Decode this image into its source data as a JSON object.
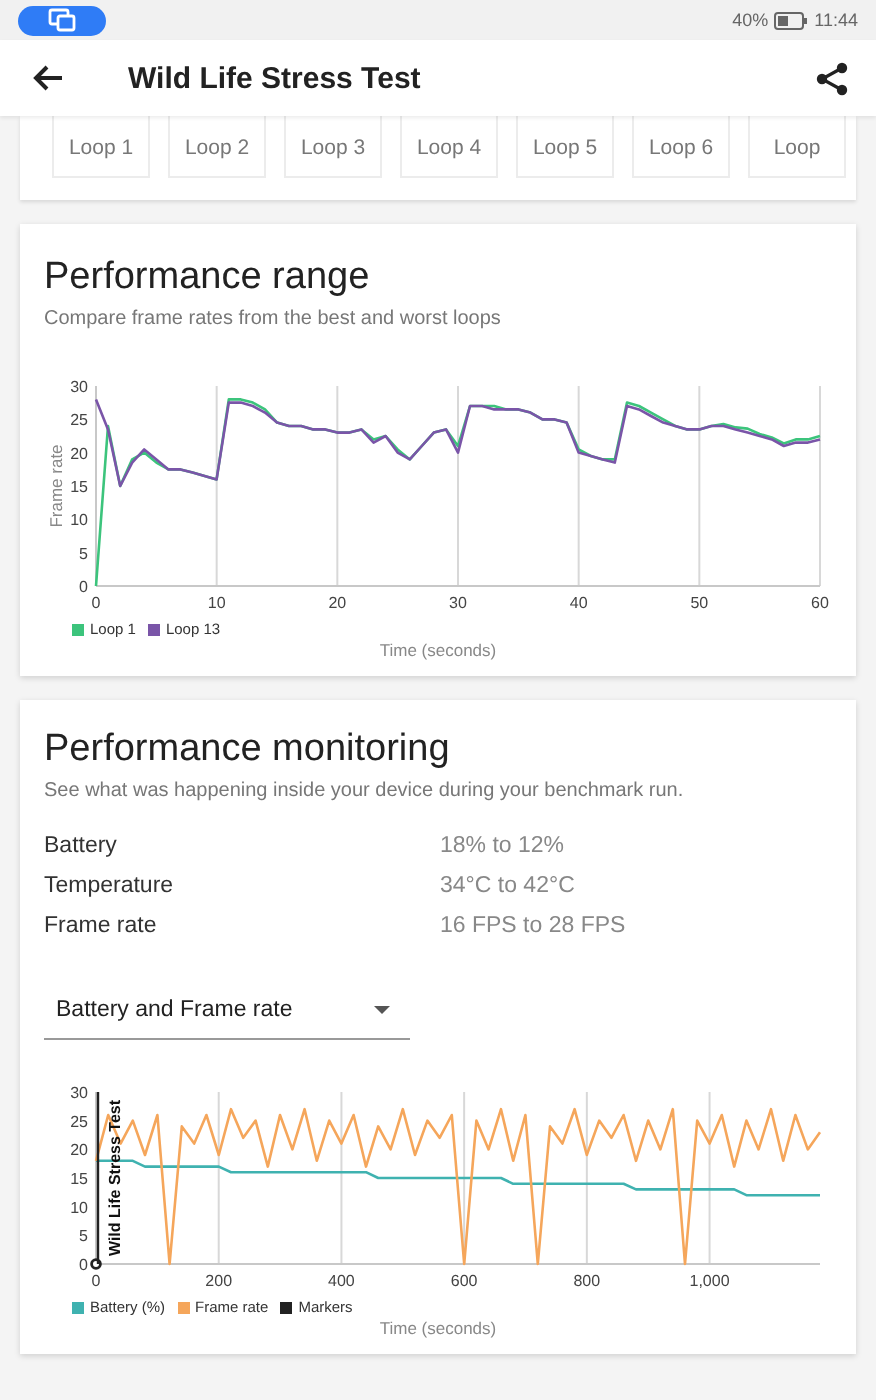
{
  "status_bar": {
    "battery_text": "40%",
    "time": "11:44"
  },
  "app_bar": {
    "title": "Wild Life Stress Test"
  },
  "loops": [
    "Loop 1",
    "Loop 2",
    "Loop 3",
    "Loop 4",
    "Loop 5",
    "Loop 6",
    "Loop"
  ],
  "performance_range": {
    "title": "Performance range",
    "subtitle": "Compare frame rates from the best and worst loops",
    "chart_data": {
      "type": "line",
      "grid": true,
      "legend": "bottom-left",
      "xlabel": "Time (seconds)",
      "ylabel": "Frame rate",
      "xlim": [
        0,
        60
      ],
      "ylim": [
        0,
        30
      ],
      "xticks": [
        0,
        10,
        20,
        30,
        40,
        50,
        60
      ],
      "yticks": [
        0,
        5,
        10,
        15,
        20,
        25,
        30
      ],
      "x": [
        0,
        1,
        2,
        3,
        4,
        5,
        6,
        7,
        8,
        9,
        10,
        11,
        12,
        13,
        14,
        15,
        16,
        17,
        18,
        19,
        20,
        21,
        22,
        23,
        24,
        25,
        26,
        27,
        28,
        29,
        30,
        31,
        32,
        33,
        34,
        35,
        36,
        37,
        38,
        39,
        40,
        41,
        42,
        43,
        44,
        45,
        46,
        47,
        48,
        49,
        50,
        51,
        52,
        53,
        54,
        55,
        56,
        57,
        58,
        59,
        60
      ],
      "series": [
        {
          "name": "Loop 1",
          "color": "#3cc47c",
          "values": [
            0,
            24,
            15,
            19,
            20,
            18.5,
            17.5,
            17.5,
            17,
            16.5,
            16,
            28,
            28,
            27.5,
            26.5,
            24.5,
            24,
            24,
            23.5,
            23.5,
            23,
            23,
            23.5,
            22,
            22.5,
            20.5,
            19,
            21,
            23,
            23.5,
            21,
            27,
            27,
            27,
            26.5,
            26.5,
            26,
            25,
            25,
            24.5,
            20.5,
            19.5,
            19,
            19,
            27.5,
            27,
            26,
            25,
            24,
            23.5,
            23.5,
            24,
            24.3,
            23.8,
            23.6,
            22.8,
            22.3,
            21.4,
            22,
            22,
            22.5
          ]
        },
        {
          "name": "Loop 13",
          "color": "#7a55a8",
          "values": [
            28,
            23.5,
            15,
            18.5,
            20.5,
            19,
            17.5,
            17.5,
            17,
            16.5,
            16,
            27.5,
            27.5,
            27,
            26,
            24.5,
            24,
            24,
            23.5,
            23.5,
            23,
            23,
            23.5,
            21.5,
            22.5,
            20,
            19,
            21,
            23,
            23.5,
            20,
            27,
            27,
            26.5,
            26.5,
            26.5,
            26,
            25,
            25,
            24.5,
            20,
            19.5,
            19,
            18.5,
            27,
            26.5,
            25.5,
            24.5,
            24,
            23.5,
            23.5,
            24,
            24,
            23.5,
            23,
            22.5,
            22,
            21,
            21.5,
            21.5,
            22
          ]
        }
      ]
    }
  },
  "performance_monitoring": {
    "title": "Performance monitoring",
    "subtitle": "See what was happening inside your device during your benchmark run.",
    "metrics": [
      {
        "label": "Battery",
        "value": "18% to 12%"
      },
      {
        "label": "Temperature",
        "value": "34°C to 42°C"
      },
      {
        "label": "Frame rate",
        "value": "16 FPS to 28 FPS"
      }
    ],
    "dropdown": {
      "value": "Battery and Frame rate"
    },
    "chart_data": {
      "type": "line",
      "grid": true,
      "legend": "bottom-left",
      "xlabel": "Time (seconds)",
      "xlim": [
        0,
        1180
      ],
      "ylim": [
        0,
        30
      ],
      "xticks": [
        0,
        200,
        400,
        600,
        800,
        {
          "value": 1000,
          "label": "1,000"
        }
      ],
      "yticks": [
        0,
        5,
        10,
        15,
        20,
        25,
        30
      ],
      "x": [
        0,
        20,
        40,
        60,
        80,
        100,
        120,
        140,
        160,
        180,
        200,
        220,
        240,
        260,
        280,
        300,
        320,
        340,
        360,
        380,
        400,
        420,
        440,
        460,
        480,
        500,
        520,
        540,
        560,
        580,
        600,
        620,
        640,
        660,
        680,
        700,
        720,
        740,
        760,
        780,
        800,
        820,
        840,
        860,
        880,
        900,
        920,
        940,
        960,
        980,
        1000,
        1020,
        1040,
        1060,
        1080,
        1100,
        1120,
        1140,
        1160,
        1180
      ],
      "series": [
        {
          "name": "Battery (%)",
          "color": "#3fb2b0",
          "values": [
            18,
            18,
            18,
            18,
            17,
            17,
            17,
            17,
            17,
            17,
            17,
            16,
            16,
            16,
            16,
            16,
            16,
            16,
            16,
            16,
            16,
            16,
            16,
            15,
            15,
            15,
            15,
            15,
            15,
            15,
            15,
            15,
            15,
            15,
            14,
            14,
            14,
            14,
            14,
            14,
            14,
            14,
            14,
            14,
            13,
            13,
            13,
            13,
            13,
            13,
            13,
            13,
            13,
            12,
            12,
            12,
            12,
            12,
            12,
            12
          ]
        },
        {
          "name": "Frame rate",
          "color": "#f5a65b",
          "values": [
            18,
            26,
            21,
            25,
            19,
            26,
            0,
            24,
            21,
            26,
            19,
            27,
            22,
            25,
            17,
            26,
            20,
            27,
            18,
            25,
            21,
            26,
            17,
            24,
            20,
            27,
            19,
            25,
            22,
            26,
            0,
            25,
            20,
            27,
            18,
            26,
            0,
            24,
            21,
            27,
            19,
            25,
            22,
            26,
            18,
            25,
            20,
            27,
            0,
            25,
            21,
            26,
            17,
            25,
            20,
            27,
            18,
            26,
            20,
            23
          ]
        },
        {
          "name": "Markers",
          "color": "#222222",
          "marker": true,
          "values": [
            0,
            null,
            null,
            null,
            null,
            null,
            null,
            null,
            null,
            null,
            null,
            null,
            null,
            null,
            null,
            null,
            null,
            null,
            null,
            null,
            null,
            null,
            null,
            null,
            null,
            null,
            null,
            null,
            null,
            null,
            null,
            null,
            null,
            null,
            null,
            null,
            null,
            null,
            null,
            null,
            null,
            null,
            null,
            null,
            null,
            null,
            null,
            null,
            null,
            null,
            null,
            null,
            null,
            null,
            null,
            null,
            null,
            null,
            null,
            null
          ]
        }
      ],
      "annotations": [
        "Wild Life Stress Test"
      ]
    }
  }
}
